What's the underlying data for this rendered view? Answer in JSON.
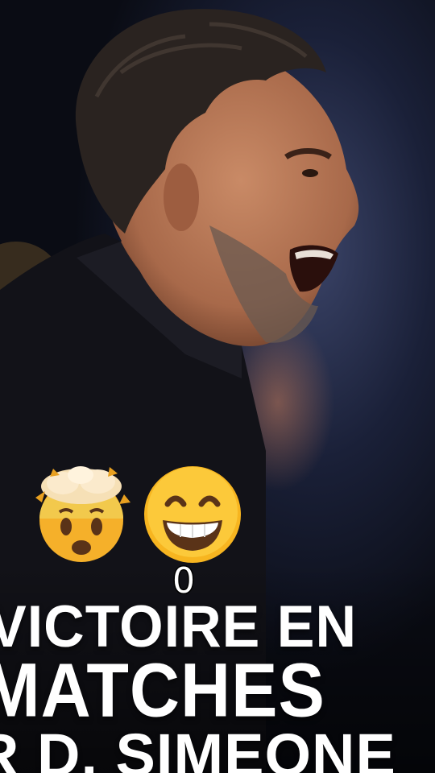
{
  "overlay": {
    "emojis": [
      "exploding-head-emoji",
      "grinning-face-with-smiling-eyes-emoji"
    ],
    "caption_number": "0"
  },
  "headline": {
    "line1": "VICTOIRE EN",
    "line2": "MATCHES",
    "line3": "R D. SIMEONE"
  }
}
